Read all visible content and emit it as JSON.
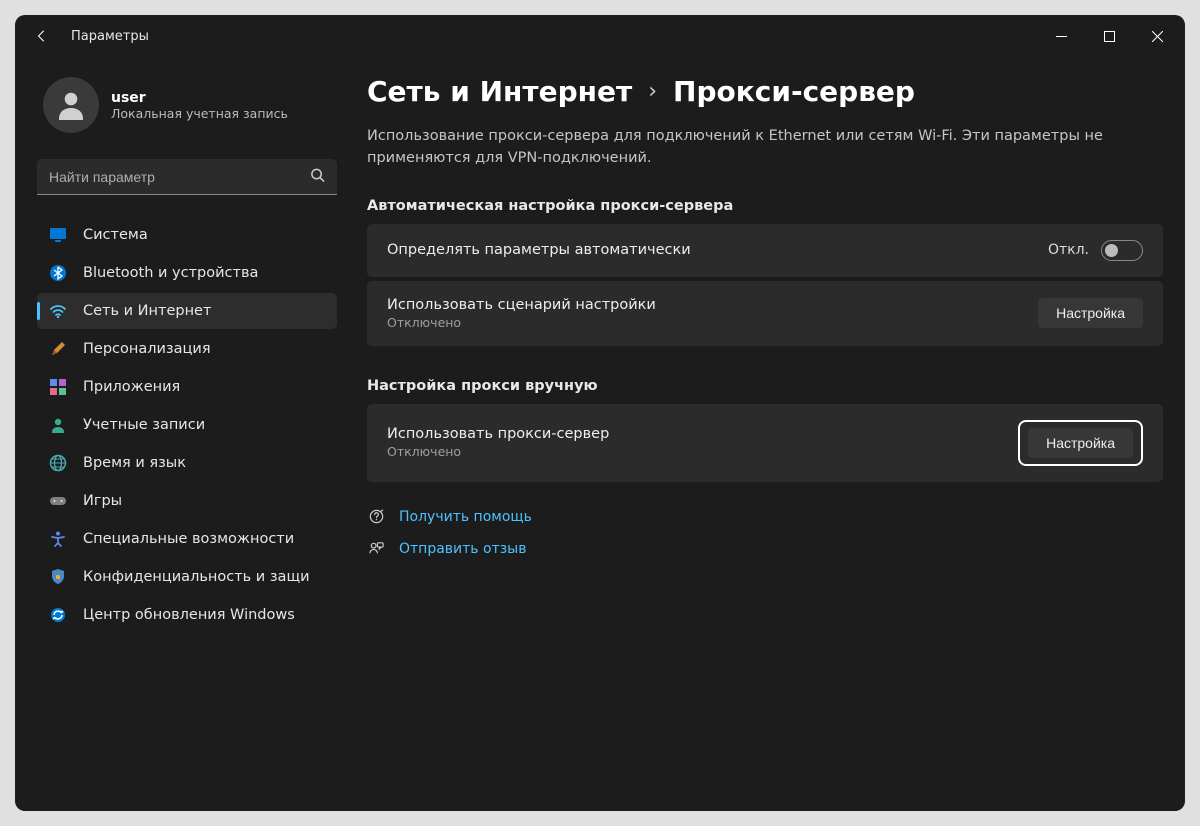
{
  "titlebar": {
    "title": "Параметры"
  },
  "user": {
    "name": "user",
    "sub": "Локальная учетная запись"
  },
  "search": {
    "placeholder": "Найти параметр"
  },
  "sidebar": {
    "items": [
      {
        "icon": "display-icon",
        "label": "Система"
      },
      {
        "icon": "bluetooth-icon",
        "label": "Bluetooth и устройства"
      },
      {
        "icon": "wifi-icon",
        "label": "Сеть и Интернет"
      },
      {
        "icon": "brush-icon",
        "label": "Персонализация"
      },
      {
        "icon": "apps-icon",
        "label": "Приложения"
      },
      {
        "icon": "person-icon",
        "label": "Учетные записи"
      },
      {
        "icon": "globe-icon",
        "label": "Время и язык"
      },
      {
        "icon": "gamepad-icon",
        "label": "Игры"
      },
      {
        "icon": "accessibility-icon",
        "label": "Специальные возможности"
      },
      {
        "icon": "shield-icon",
        "label": "Конфиденциальность и защи"
      },
      {
        "icon": "update-icon",
        "label": "Центр обновления Windows"
      }
    ]
  },
  "main": {
    "bc_parent": "Сеть и Интернет",
    "bc_current": "Прокси-сервер",
    "description": "Использование прокси-сервера для подключений к Ethernet или сетям Wi-Fi. Эти параметры не применяются для VPN-подключений.",
    "section_auto": "Автоматическая настройка прокси-сервера",
    "card_auto_detect": {
      "title": "Определять параметры автоматически",
      "toggle_state": "Откл."
    },
    "card_script": {
      "title": "Использовать сценарий настройки",
      "sub": "Отключено",
      "btn": "Настройка"
    },
    "section_manual": "Настройка прокси вручную",
    "card_manual": {
      "title": "Использовать прокси-сервер",
      "sub": "Отключено",
      "btn": "Настройка"
    },
    "help_link": "Получить помощь",
    "feedback_link": "Отправить отзыв"
  }
}
